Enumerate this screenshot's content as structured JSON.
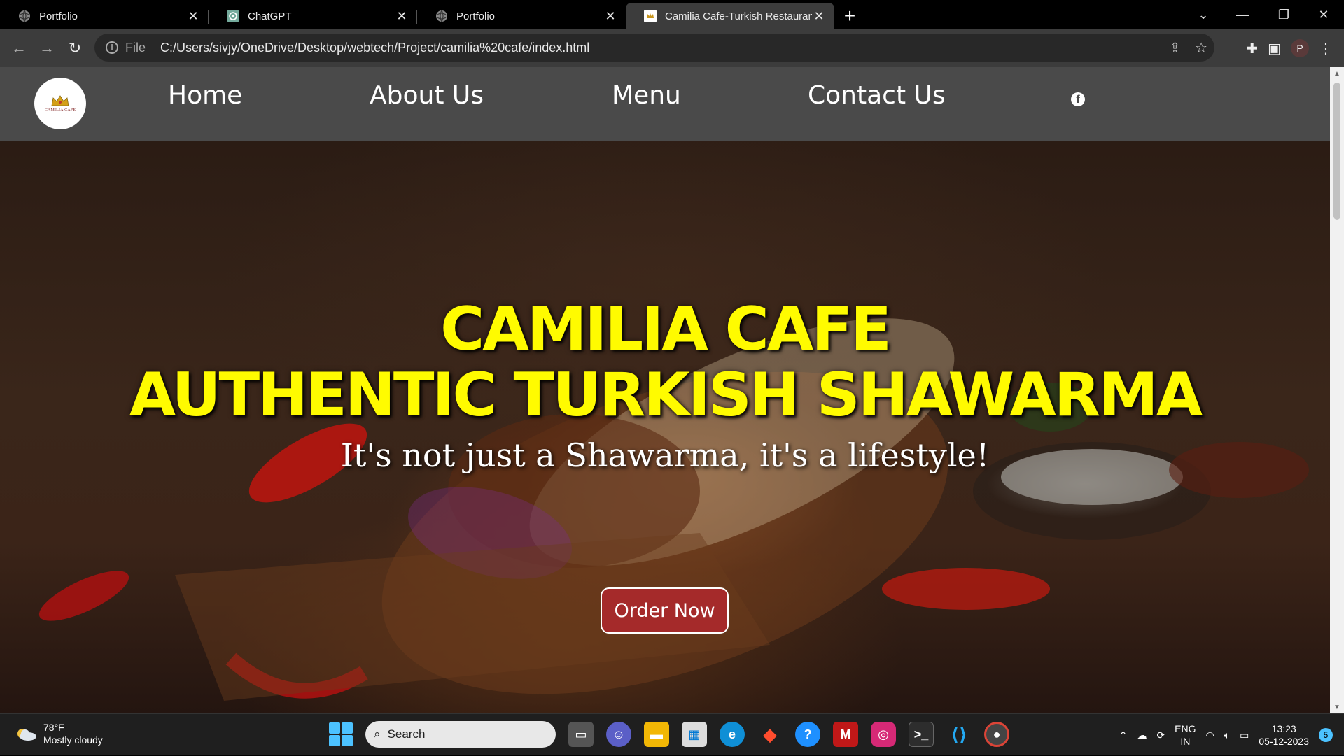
{
  "browser": {
    "tabs": [
      {
        "title": "Portfolio",
        "icon": "globe-icon",
        "active": false
      },
      {
        "title": "ChatGPT",
        "icon": "chatgpt-icon",
        "active": false
      },
      {
        "title": "Portfolio",
        "icon": "globe-icon",
        "active": false
      },
      {
        "title": "Camilia Cafe-Turkish Restaurant",
        "icon": "camilia-favicon",
        "active": true
      }
    ],
    "address": {
      "scheme_label": "File",
      "url": "C:/Users/sivjy/OneDrive/Desktop/webtech/Project/camilia%20cafe/index.html"
    },
    "profile_initial": "P"
  },
  "site": {
    "logo": {
      "text": "CAMILIA CAFE"
    },
    "nav": {
      "home": "Home",
      "about": "About Us",
      "menu": "Menu",
      "contact": "Contact Us",
      "social_icon": "facebook-icon"
    },
    "hero": {
      "title_line1": "CAMILIA CAFE",
      "title_line2": "AUTHENTIC TURKISH SHAWARMA",
      "subtitle": "It's not just a Shawarma, it's a lifestyle!",
      "cta": "Order Now"
    },
    "colors": {
      "navbar": "#4a4a4a",
      "hero_title": "#fffb00",
      "cta_bg": "#a52a2a"
    }
  },
  "taskbar": {
    "weather": {
      "temp": "78°F",
      "condition": "Mostly cloudy"
    },
    "search_placeholder": "Search",
    "language": {
      "line1": "ENG",
      "line2": "IN"
    },
    "clock": {
      "time": "13:23",
      "date": "05-12-2023"
    },
    "notifications": "5"
  }
}
